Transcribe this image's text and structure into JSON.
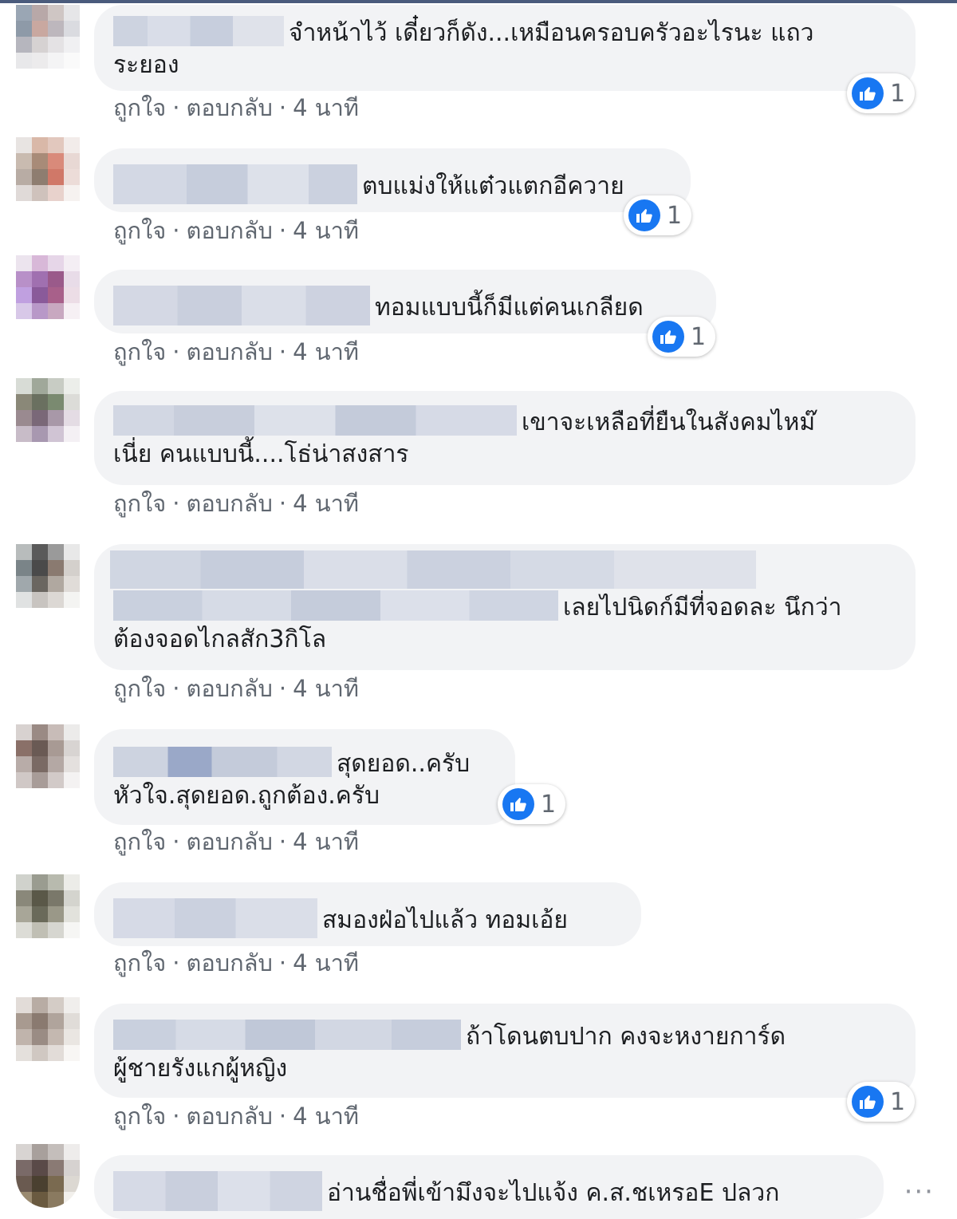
{
  "colors": {
    "like_blue": "#1877f2",
    "bubble_bg": "#f2f3f5",
    "meta_text": "#606770"
  },
  "actions": {
    "like": "ถูกใจ",
    "reply": "ตอบกลับ",
    "separator": "·",
    "time": "4 นาที"
  },
  "comments": [
    {
      "line1": "จำหน้าไว้ เดี๋ยวก็ดัง...เหมือนครอบครัวอะไรนะ แถว",
      "line2": "ระยอง",
      "reactions": "1"
    },
    {
      "line1": "ตบแม่งให้แต๋วแตกอีควาย",
      "line2": "",
      "reactions": "1"
    },
    {
      "line1": "ทอมแบบนี้ก็มีแต่คนเกลียด",
      "line2": "",
      "reactions": "1"
    },
    {
      "line1": "เขาจะเหลือที่ยืนในสังคมไหม๊",
      "line2": "เนี่ย คนแบบนี้....โธ่น่าสงสาร",
      "reactions": ""
    },
    {
      "line1": "เลยไปนิดก์มีที่จอดละ นึกว่า",
      "line2": "ต้องจอดไกลสัก3กิโล",
      "reactions": ""
    },
    {
      "line1": "สุดยอด..ครับ",
      "line2": "หัวใจ.สุดยอด.ถูกต้อง.ครับ",
      "reactions": "1"
    },
    {
      "line1": "สมองฝ่อไปแล้ว ทอมเอ้ย",
      "line2": "",
      "reactions": ""
    },
    {
      "line1": "ถ้าโดนตบปาก คงจะหงายการ์ด",
      "line2": "ผู้ชายรังแกผู้หญิง",
      "reactions": "1"
    },
    {
      "line1": "อ่านชื่อพี่เข้ามึงจะไปแจ้ง ค.ส.ชเหรอE ปลวก",
      "line2": "",
      "reactions": ""
    }
  ],
  "more_icon": "more-options-icon",
  "more_glyph": "···"
}
